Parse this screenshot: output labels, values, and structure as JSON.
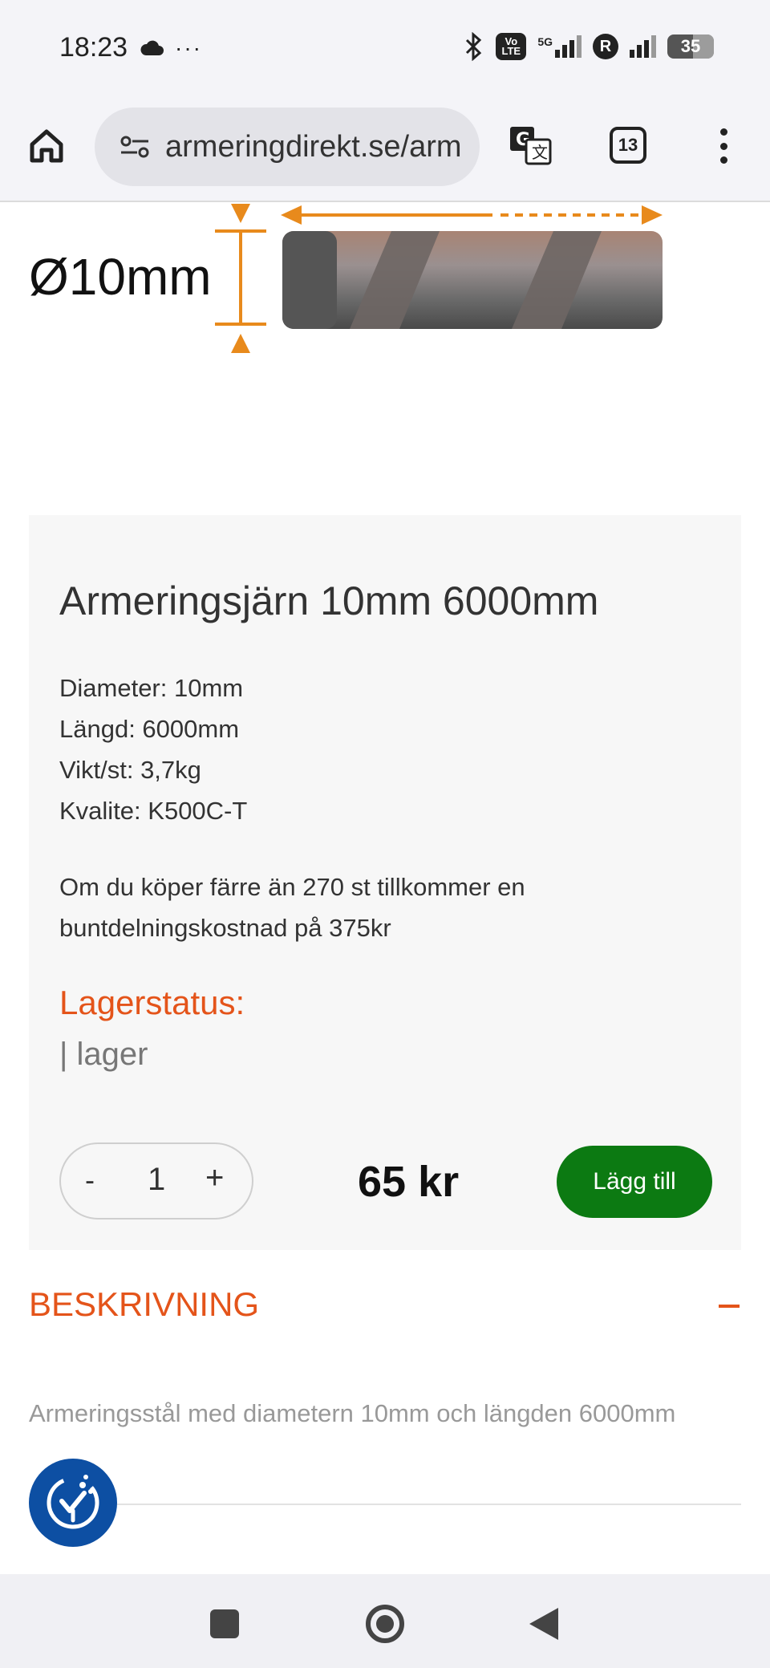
{
  "status_bar": {
    "time": "18:23",
    "network_label": "5G",
    "volte_label": "Vo LTE",
    "roaming_label": "R",
    "battery": "35"
  },
  "browser": {
    "url": "armeringdirekt.se/arm",
    "tab_count": "13"
  },
  "product_image": {
    "diameter_label": "Ø10mm"
  },
  "product": {
    "title": "Armeringsjärn 10mm 6000mm",
    "specs": {
      "diameter": "Diameter: 10mm",
      "length": "Längd: 6000mm",
      "weight": "Vikt/st: 3,7kg",
      "quality": "Kvalite: K500C-T"
    },
    "bundle_note": "Om du köper färre än 270 st tillkommer en buntdelningskostnad på 375kr",
    "stock_label": "Lagerstatus:",
    "stock_value": "| lager",
    "quantity": {
      "minus": "-",
      "value": "1",
      "plus": "+"
    },
    "price": "65 kr",
    "add_button": "Lägg till"
  },
  "description": {
    "heading": "BESKRIVNING",
    "text": "Armeringsstål med diametern 10mm och längden 6000mm"
  },
  "colors": {
    "accent": "#e4541a",
    "add_button": "#0c7a12",
    "cookie_button": "#0d4fa3"
  },
  "icons": {
    "home": "home-icon",
    "site_settings": "tune-icon",
    "translate": "translate-icon",
    "menu": "more-vert-icon",
    "cookie": "cookie-consent-icon"
  }
}
